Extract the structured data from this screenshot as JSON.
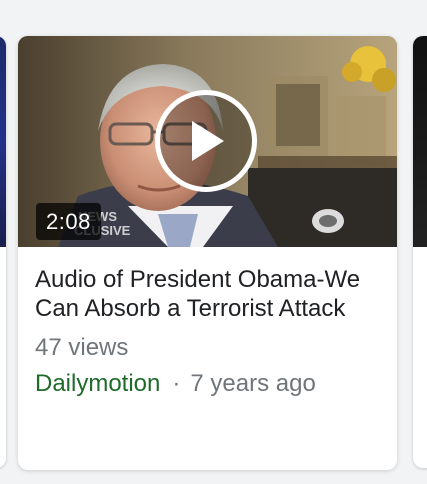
{
  "video_card": {
    "duration": "2:08",
    "title": "Audio of President Obama-We Can Absorb a Terrorist Attack",
    "views": "47 views",
    "source": "Dailymotion",
    "separator": "·",
    "age": "7 years ago",
    "thumbnail_overlay_text": [
      "NEWS",
      "CLUSIVE"
    ]
  },
  "colors": {
    "source_green": "#1e6b2a",
    "meta_gray": "#70757a",
    "title_text": "#202124",
    "page_background": "#f1f3f4"
  },
  "icons": {
    "play": "play-circle-icon"
  }
}
